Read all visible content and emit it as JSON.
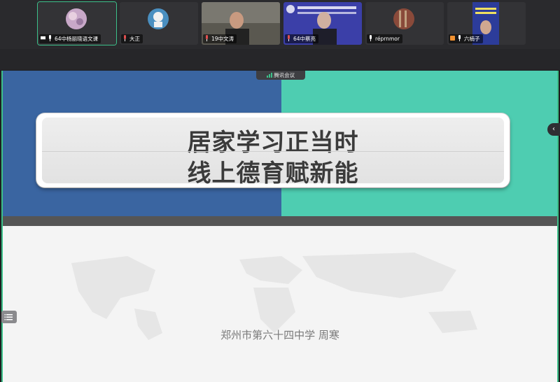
{
  "participants": [
    {
      "name": "64中杨丽晓语文课"
    },
    {
      "name": "大正"
    },
    {
      "name": "19中文涛"
    },
    {
      "name": "64中蔡亮"
    },
    {
      "name": "réprnmor"
    },
    {
      "name": "六楠子"
    }
  ],
  "meeting_badge": "腾讯会议",
  "side_toggle": "‹",
  "slide": {
    "title_line1": "居家学习正当时",
    "title_line2": "线上德育赋新能",
    "subtitle": "郑州市第六十四中学 周寒"
  },
  "colors": {
    "panel_left": "#3a65a1",
    "panel_right": "#4ecdb1",
    "accent_green": "#3cc08a"
  }
}
